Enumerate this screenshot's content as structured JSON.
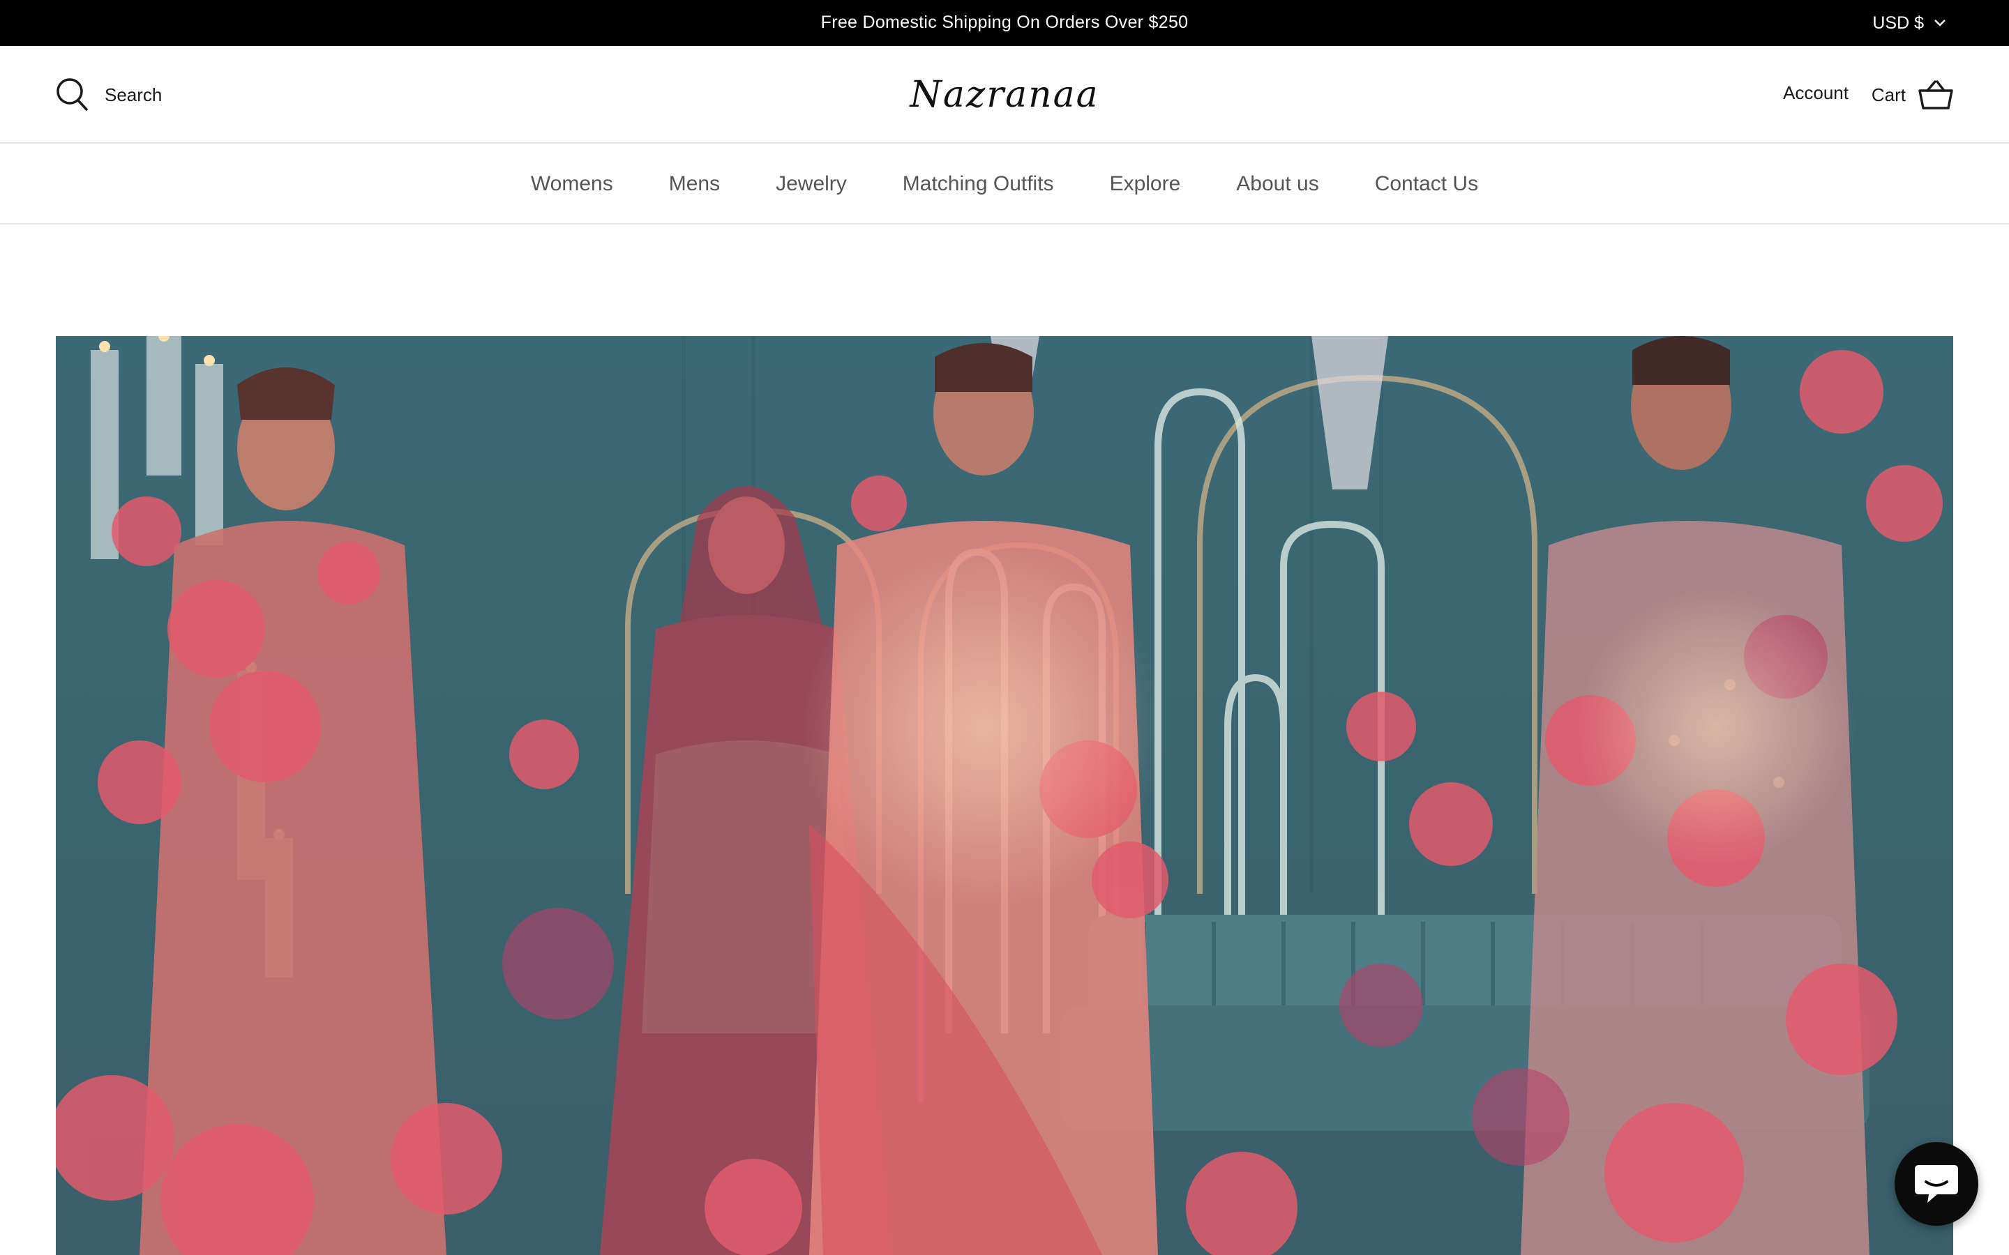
{
  "announcement": {
    "text": "Free Domestic Shipping On Orders Over $250",
    "currency": "USD $",
    "currency_icon": "chevron-down-icon"
  },
  "header": {
    "search_label": "Search",
    "search_icon": "search-icon",
    "logo_text": "Nazranaa",
    "account_label": "Account",
    "cart_label": "Cart",
    "cart_icon": "basket-icon"
  },
  "nav": {
    "items": [
      {
        "label": "Womens"
      },
      {
        "label": "Mens"
      },
      {
        "label": "Jewelry"
      },
      {
        "label": "Matching Outfits"
      },
      {
        "label": "Explore"
      },
      {
        "label": "About us"
      },
      {
        "label": "Contact Us"
      }
    ]
  },
  "hero": {
    "image": "wedding-outfits-photo",
    "colors": {
      "backdrop": "#2f6d7a",
      "florals": "#e0576a",
      "sofa": "#3f7c88"
    }
  },
  "chat": {
    "icon": "chat-icon",
    "color": "#0b0b0b"
  }
}
